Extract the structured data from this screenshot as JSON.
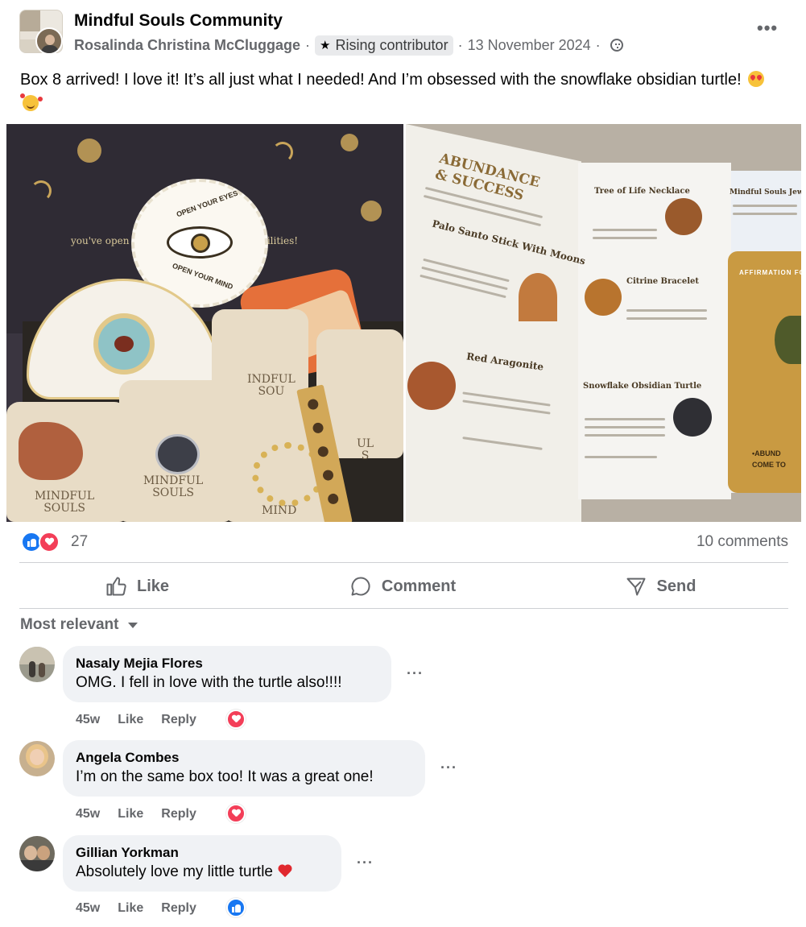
{
  "post": {
    "group_name": "Mindful Souls Community",
    "author": "Rosalinda Christina McCluggage",
    "badge": "Rising contributor",
    "date": "13 November 2024",
    "text": "Box 8 arrived! I love it! It’s all just what I needed! And I’m obsessed with the snowflake obsidian turtle!",
    "text_emojis": [
      "heart-eyes-emoji",
      "smiling-face-with-hearts-emoji"
    ]
  },
  "photo_left": {
    "lid_text_left": "you've open",
    "lid_text_right": "ssibilities!",
    "eye_card_top": "OPEN YOUR EYES",
    "eye_card_bottom": "OPEN YOUR MIND",
    "pouch_1": "MINDFUL\nSOULS",
    "pouch_2": "MINDFUL\nSOULS",
    "pouch_3": "MIND",
    "pouch_4": "INDFUL\nSOU",
    "pouch_5": "UL\nS"
  },
  "photo_right": {
    "title_line1": "ABUNDANCE",
    "title_line2": "& SUCCESS",
    "head_palo": "Palo Santo Stick With Moons",
    "head_aragonite": "Red Aragonite",
    "head_tree": "Tree of Life Necklace",
    "head_citrine": "Citrine Bracelet",
    "head_turtle": "Snowflake Obsidian Turtle",
    "head_jewel": "Mindful Souls Jewel",
    "card_top": "AFFIRMATION FOR C",
    "card_bottom1": "•ABUND",
    "card_bottom2": "COME TO"
  },
  "reactions": {
    "icons": [
      "like-icon",
      "love-icon"
    ],
    "count": "27",
    "comments_label": "10 comments"
  },
  "actions": {
    "like": "Like",
    "comment": "Comment",
    "send": "Send"
  },
  "sort": {
    "label": "Most relevant"
  },
  "comments": [
    {
      "name": "Nasaly Mejia Flores",
      "text": "OMG. I fell in love with the turtle also!!!!",
      "time": "45w",
      "like": "Like",
      "reply": "Reply",
      "reaction": "love-icon"
    },
    {
      "name": "Angela Combes",
      "text": "I’m on the same box too! It was a great one!",
      "time": "45w",
      "like": "Like",
      "reply": "Reply",
      "reaction": "love-icon"
    },
    {
      "name": "Gillian Yorkman",
      "text": "Absolutely love my little turtle",
      "time": "45w",
      "like": "Like",
      "reply": "Reply",
      "reaction": "like-icon",
      "text_emoji": "red-heart-emoji"
    }
  ],
  "colors": {
    "like_blue": "#1877f2",
    "love_red": "#f33e58",
    "secondary_text": "#65676b",
    "bubble_bg": "#f0f2f5"
  }
}
